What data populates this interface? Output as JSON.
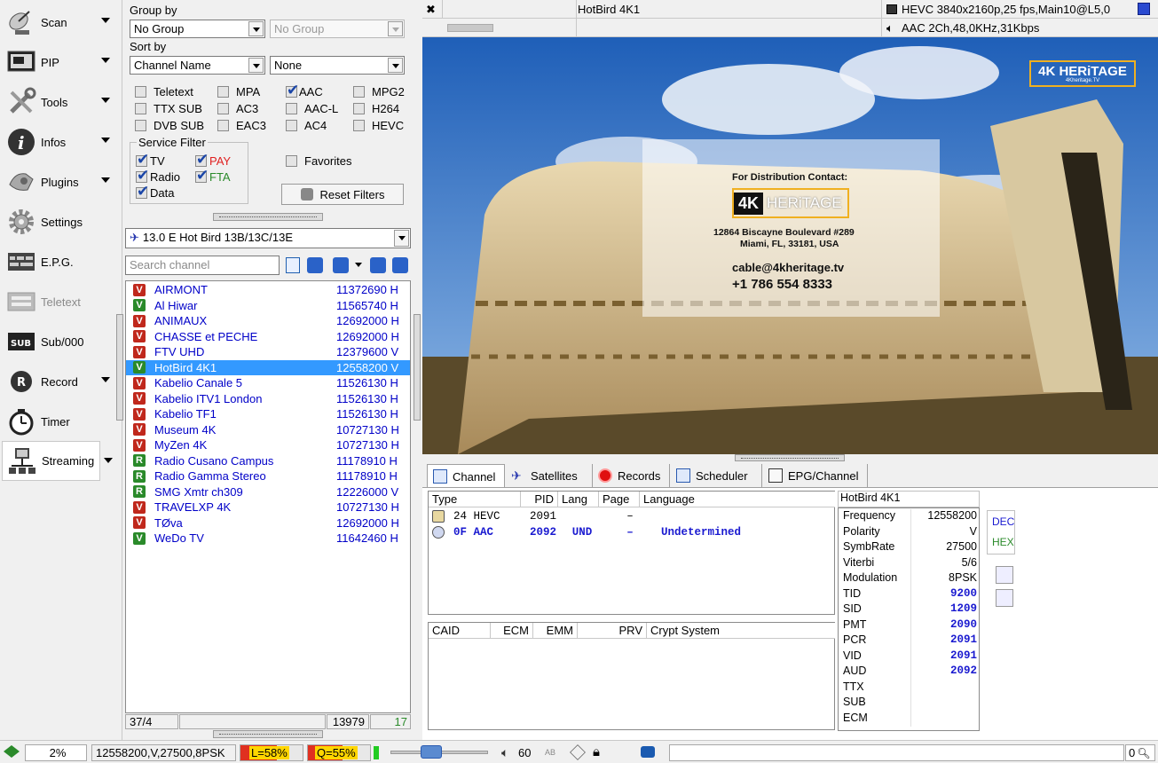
{
  "sidebar": {
    "items": [
      {
        "label": "Scan",
        "icon": "satellite-dish-icon",
        "arrow": true
      },
      {
        "label": "PIP",
        "icon": "pip-monitor-icon",
        "arrow": true
      },
      {
        "label": "Tools",
        "icon": "tools-icon",
        "arrow": true
      },
      {
        "label": "Infos",
        "icon": "info-icon",
        "arrow": true
      },
      {
        "label": "Plugins",
        "icon": "plugins-icon",
        "arrow": true
      },
      {
        "label": "Settings",
        "icon": "gear-icon",
        "arrow": false
      },
      {
        "label": "E.P.G.",
        "icon": "epg-icon",
        "arrow": false
      },
      {
        "label": "Teletext",
        "icon": "teletext-icon",
        "arrow": false,
        "disabled": true
      },
      {
        "label": "Sub/000",
        "icon": "subtitle-icon",
        "arrow": false
      },
      {
        "label": "Record",
        "icon": "record-icon",
        "arrow": true
      },
      {
        "label": "Timer",
        "icon": "timer-icon",
        "arrow": false
      },
      {
        "label": "Streaming",
        "icon": "network-icon",
        "arrow": true,
        "active": true
      }
    ]
  },
  "filters": {
    "group_by_label": "Group by",
    "group_by_value": "No Group",
    "group_by_secondary": "No Group",
    "sort_by_label": "Sort by",
    "sort_by_value": "Channel Name",
    "sort_by_secondary": "None",
    "streams": [
      {
        "label": "Teletext",
        "checked": false
      },
      {
        "label": "MPA",
        "checked": false
      },
      {
        "label": "AAC",
        "checked": true
      },
      {
        "label": "MPG2",
        "checked": false
      },
      {
        "label": "TTX SUB",
        "checked": false
      },
      {
        "label": "AC3",
        "checked": false
      },
      {
        "label": "AAC-L",
        "checked": false
      },
      {
        "label": "H264",
        "checked": false
      },
      {
        "label": "DVB SUB",
        "checked": false
      },
      {
        "label": "EAC3",
        "checked": false
      },
      {
        "label": "AC4",
        "checked": false
      },
      {
        "label": "HEVC",
        "checked": false
      }
    ],
    "service_filter_label": "Service Filter",
    "service": {
      "tv": "TV",
      "pay": "PAY",
      "radio": "Radio",
      "fta": "FTA",
      "data": "Data"
    },
    "favorites_label": "Favorites",
    "reset_label": "Reset Filters"
  },
  "satellite": {
    "value": "13.0 E Hot Bird 13B/13C/13E"
  },
  "search": {
    "placeholder": "Search channel"
  },
  "channels": [
    {
      "badge": "V",
      "color": "red",
      "name": "AIRMONT",
      "freq": "11372690 H"
    },
    {
      "badge": "V",
      "color": "green",
      "name": "Al Hiwar",
      "freq": "11565740 H"
    },
    {
      "badge": "V",
      "color": "red",
      "name": "ANIMAUX",
      "freq": "12692000 H"
    },
    {
      "badge": "V",
      "color": "red",
      "name": "CHASSE et PECHE",
      "freq": "12692000 H"
    },
    {
      "badge": "V",
      "color": "red",
      "name": "FTV UHD",
      "freq": "12379600 V"
    },
    {
      "badge": "V",
      "color": "green",
      "name": "HotBird 4K1",
      "freq": "12558200 V",
      "selected": true
    },
    {
      "badge": "V",
      "color": "red",
      "name": "Kabelio Canale 5",
      "freq": "11526130 H"
    },
    {
      "badge": "V",
      "color": "red",
      "name": "Kabelio ITV1 London",
      "freq": "11526130 H"
    },
    {
      "badge": "V",
      "color": "red",
      "name": "Kabelio TF1",
      "freq": "11526130 H"
    },
    {
      "badge": "V",
      "color": "red",
      "name": "Museum 4K",
      "freq": "10727130 H"
    },
    {
      "badge": "V",
      "color": "red",
      "name": "MyZen 4K",
      "freq": "10727130 H"
    },
    {
      "badge": "R",
      "color": "green",
      "name": "Radio Cusano Campus",
      "freq": "11178910 H"
    },
    {
      "badge": "R",
      "color": "green",
      "name": "Radio Gamma Stereo",
      "freq": "11178910 H"
    },
    {
      "badge": "R",
      "color": "green",
      "name": "SMG Xmtr ch309",
      "freq": "12226000 V"
    },
    {
      "badge": "V",
      "color": "red",
      "name": "TRAVELXP 4K",
      "freq": "10727130 H"
    },
    {
      "badge": "V",
      "color": "red",
      "name": "TØva",
      "freq": "12692000 H"
    },
    {
      "badge": "V",
      "color": "green",
      "name": "WeDo TV",
      "freq": "11642460 H"
    }
  ],
  "list_footer": {
    "count": "37/4",
    "total": "13979",
    "green": "17"
  },
  "top_info": {
    "channel": "HotBird 4K1",
    "video": "HEVC 3840x2160p,25 fps,Main10@L5,0",
    "audio": "AAC 2Ch,48,0KHz,31Kbps"
  },
  "video_overlay": {
    "brand": "4K HERiTAGE",
    "brand_sub": "4Kheritage.TV",
    "contact_title": "For Distribution Contact:",
    "logo_4k": "4K",
    "logo_heritage": "HERiTAGE",
    "address1": "12864 Biscayne Boulevard #289",
    "address2": "Miami, FL, 33181, USA",
    "email": "cable@4kheritage.tv",
    "phone": "+1 786 554 8333"
  },
  "tabs": [
    "Channel",
    "Satellites",
    "Records",
    "Scheduler",
    "EPG/Channel"
  ],
  "streams_table": {
    "headers": [
      "Type",
      "PID",
      "Lang",
      "Page",
      "Language"
    ],
    "rows": [
      {
        "type": "24 HEVC",
        "pid": "2091",
        "lang": "",
        "page": "–",
        "language": "",
        "color": "#000"
      },
      {
        "type": "0F AAC",
        "pid": "2092",
        "lang": "UND",
        "page": "–",
        "language": "Undetermined",
        "color": "#1a1ad0"
      }
    ]
  },
  "crypt_table": {
    "headers": [
      "CAID",
      "ECM",
      "EMM",
      "PRV",
      "Crypt System"
    ]
  },
  "props": {
    "title": "HotBird 4K1",
    "rows": [
      {
        "k": "Frequency",
        "v": "12558200",
        "blue": false
      },
      {
        "k": "Polarity",
        "v": "V",
        "blue": false
      },
      {
        "k": "SymbRate",
        "v": "27500",
        "blue": false
      },
      {
        "k": "Viterbi",
        "v": "5/6",
        "blue": false
      },
      {
        "k": "Modulation",
        "v": "8PSK",
        "blue": false
      },
      {
        "k": "TID",
        "v": "9200",
        "blue": true
      },
      {
        "k": "SID",
        "v": "1209",
        "blue": true
      },
      {
        "k": "PMT",
        "v": "2090",
        "blue": true
      },
      {
        "k": "PCR",
        "v": "2091",
        "blue": true
      },
      {
        "k": "VID",
        "v": "2091",
        "blue": true
      },
      {
        "k": "AUD",
        "v": "2092",
        "blue": true
      },
      {
        "k": "TTX",
        "v": "",
        "blue": false
      },
      {
        "k": "SUB",
        "v": "",
        "blue": false
      },
      {
        "k": "ECM",
        "v": "",
        "blue": false
      }
    ],
    "dec_label": "DEC",
    "hex_label": "HEX"
  },
  "status": {
    "percent": "2%",
    "tuning": "12558200,V,27500,8PSK",
    "level": "L=58%",
    "level_value": 58,
    "quality": "Q=55%",
    "quality_value": 55,
    "volume": "60",
    "volume_value": 60,
    "ab": "AB",
    "zoom": "0"
  },
  "colors": {
    "selection": "#3399ff",
    "channel_text": "#0000c8",
    "red_badge": "#c0281c",
    "green_badge": "#2a8a2a",
    "pay": "#e02020",
    "fta": "#2a8a2a"
  }
}
